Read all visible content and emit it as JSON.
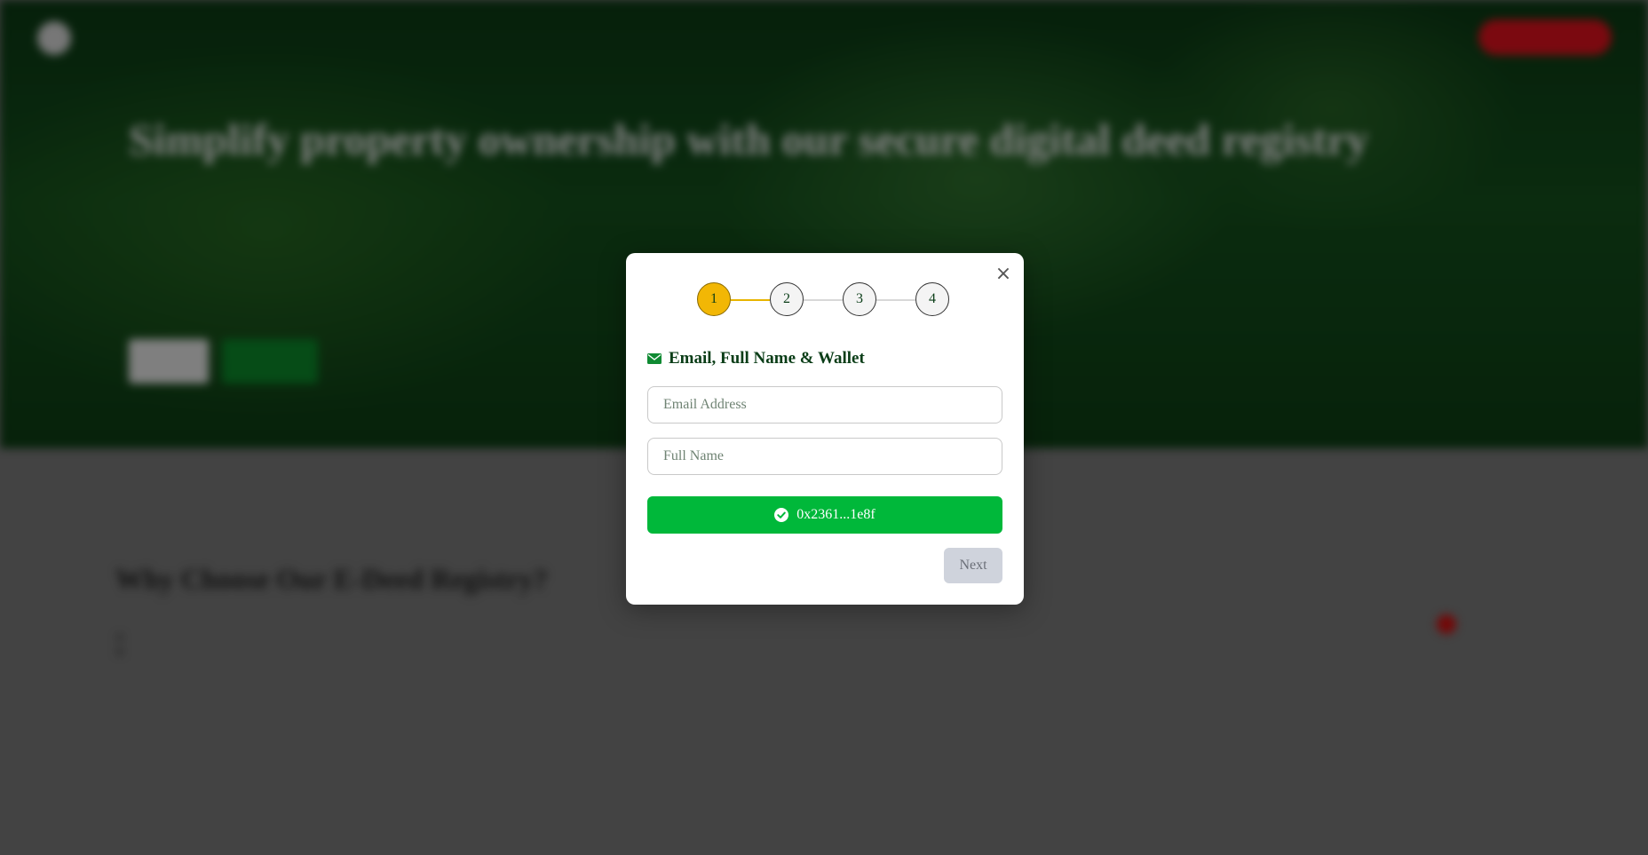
{
  "background": {
    "nav": {
      "logo_text": "",
      "link_1": "",
      "link_2": "",
      "cta": ""
    },
    "hero": {
      "title": "Simplify property ownership with our secure digital deed registry",
      "paragraph_1": "",
      "paragraph_2": "",
      "button_1": "",
      "button_2": ""
    },
    "section": {
      "title": "Why Choose Our E-Deed Registry?",
      "bullets": [
        "",
        "",
        "",
        "",
        ""
      ]
    },
    "side_card": {
      "title": "",
      "text": ""
    }
  },
  "modal": {
    "close_icon": "×",
    "steps": [
      "1",
      "2",
      "3",
      "4"
    ],
    "active_step": 1,
    "section_icon": "envelope-icon",
    "section_title": "Email, Full Name & Wallet",
    "email_placeholder": "Email Address",
    "email_value": "",
    "name_placeholder": "Full Name",
    "name_value": "",
    "wallet_icon": "check-circle-icon",
    "wallet_label": "0x2361...1e8f",
    "next_label": "Next",
    "colors": {
      "active_step": "#f2b705",
      "title": "#0a3d17",
      "wallet_button": "#00b83a",
      "next_disabled": "#cfd3dc"
    }
  }
}
